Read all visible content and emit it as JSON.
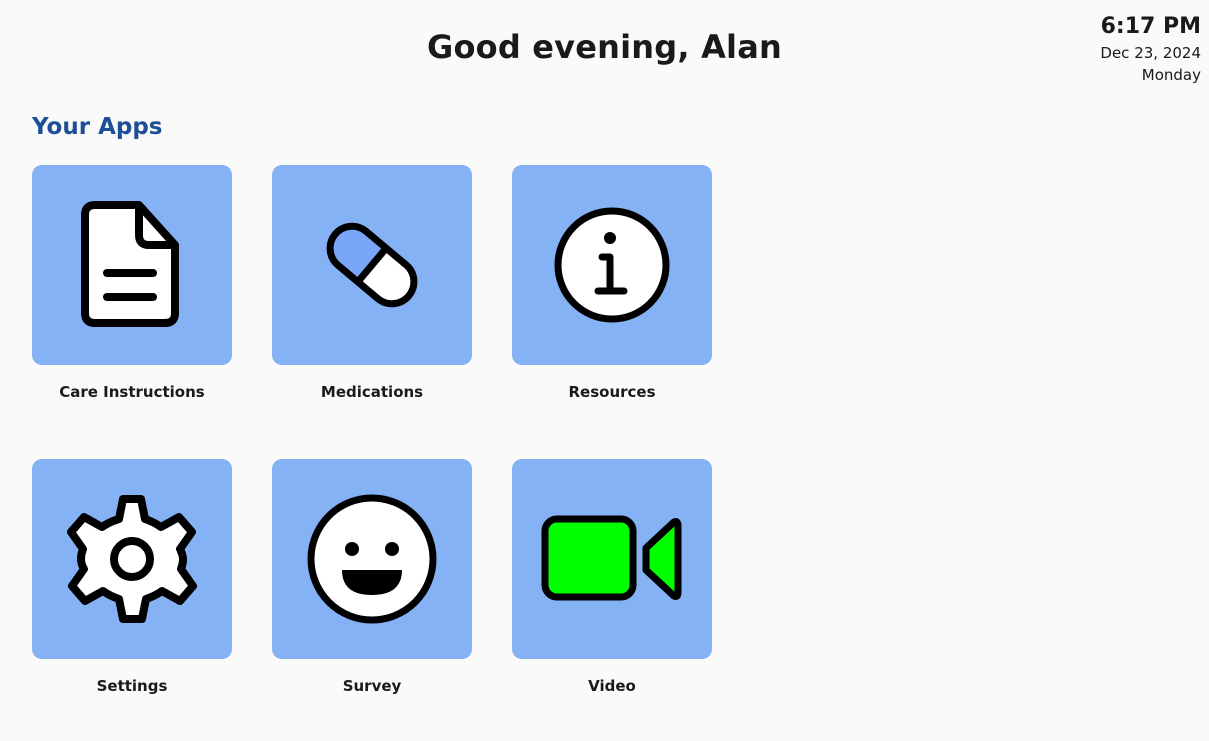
{
  "header": {
    "greeting": "Good evening, Alan",
    "time": "6:17 PM",
    "date": "Dec 23, 2024",
    "day": "Monday"
  },
  "apps_section": {
    "title": "Your Apps",
    "apps": [
      {
        "label": "Care Instructions",
        "icon": "document-icon"
      },
      {
        "label": "Medications",
        "icon": "pill-icon"
      },
      {
        "label": "Resources",
        "icon": "info-icon"
      },
      {
        "label": "Settings",
        "icon": "gear-icon"
      },
      {
        "label": "Survey",
        "icon": "smiley-face-icon"
      },
      {
        "label": "Video",
        "icon": "video-camera-icon"
      }
    ]
  },
  "colors": {
    "tile_background": "#85b2f4",
    "section_title": "#1d4e96",
    "pill_half": "#7aa6f7",
    "video_camera": "#00ff00"
  }
}
